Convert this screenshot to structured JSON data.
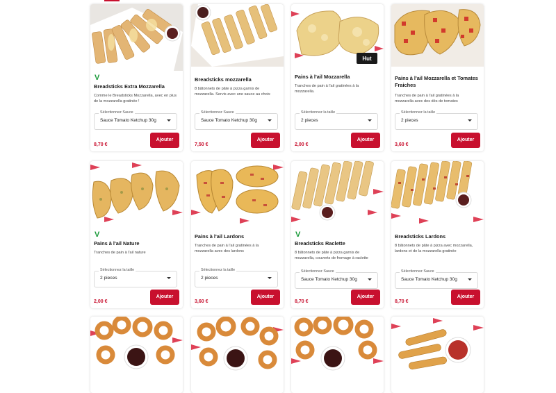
{
  "labels": {
    "add_button": "Ajouter",
    "veg_badge": "V"
  },
  "products": [
    {
      "id": "p1",
      "title": "Breadsticks Extra Mozzarella",
      "vegetarian": true,
      "description": "Comme le Breadsticks Mozzarella, avec en plus de la mozzarella gratinée !",
      "select_label": "Sélectionnez Sauce",
      "select_value": "Sauce Tomato Ketchup 30g",
      "price": "8,70 €"
    },
    {
      "id": "p2",
      "title": "Breadsticks mozzarella",
      "vegetarian": false,
      "description": "8 bâtonnets de pâte à pizza garnis de mozzarella. Servis avec une sauce au choix",
      "select_label": "Sélectionnez Sauce",
      "select_value": "Sauce Tomato Ketchup 30g",
      "price": "7,50 €"
    },
    {
      "id": "p3",
      "title": "Pains à l'ail Mozzarella",
      "vegetarian": false,
      "description": "Tranches de pain à l'ail gratinées à la mozzarella.",
      "select_label": "Sélectionnez la taille",
      "select_value": "2 pieces",
      "price": "2,00 €",
      "logo_text": "Hut"
    },
    {
      "id": "p4",
      "title": "Pains à l'ail Mozzarella et Tomates Fraiches",
      "vegetarian": false,
      "description": "Tranches de pain à l'ail gratinées à la mozzarella avec des dés de tomates",
      "select_label": "Sélectionnez la taille",
      "select_value": "2 pieces",
      "price": "3,60 €"
    },
    {
      "id": "p5",
      "title": "Pains à l'ail Nature",
      "vegetarian": true,
      "description": "Tranches de pain à l'ail nature",
      "select_label": "Sélectionnez la taille",
      "select_value": "2 pieces",
      "price": "2,00 €"
    },
    {
      "id": "p6",
      "title": "Pains à l'ail Lardons",
      "vegetarian": false,
      "description": "Tranches de pain à l'ail gratinées à la mozzarella avec des lardons",
      "select_label": "Sélectionnez la taille",
      "select_value": "2 pieces",
      "price": "3,60 €"
    },
    {
      "id": "p7",
      "title": "Breadsticks Raclette",
      "vegetarian": true,
      "description": "8 bâtonnets de pâte à pizza garnis de mozzarella, couverts de fromage à raclette",
      "select_label": "Sélectionnez Sauce",
      "select_value": "Sauce Tomato Ketchup 30g",
      "price": "8,70 €"
    },
    {
      "id": "p8",
      "title": "Breadsticks Lardons",
      "vegetarian": false,
      "description": "8 bâtonnets de pâte à pizza avec mozzarella, lardons et de la mozzarella gratinée",
      "select_label": "Sélectionnez Sauce",
      "select_value": "Sauce Tomato Ketchup 30g",
      "price": "8,70 €"
    }
  ],
  "colors": {
    "brand_red": "#c8102e",
    "veg_green": "#1a9a3a"
  },
  "icons": [
    "chevron-down-icon"
  ]
}
